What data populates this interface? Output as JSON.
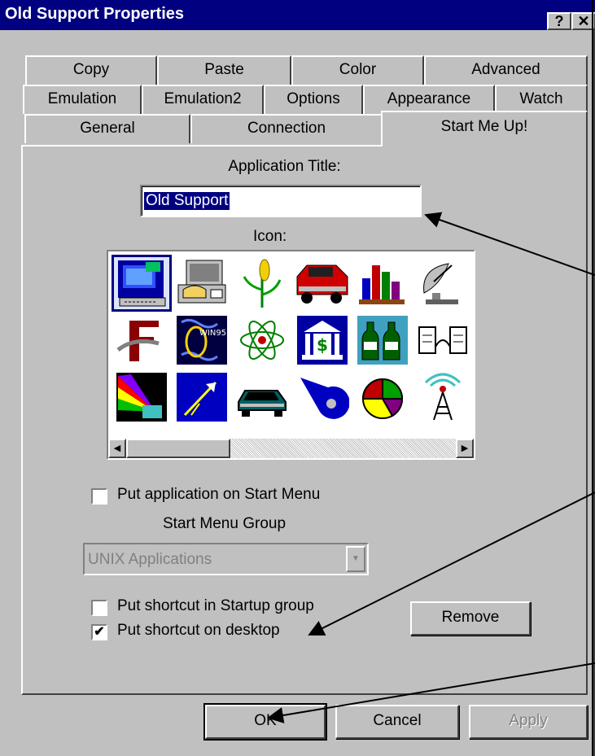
{
  "window": {
    "title": "Old Support Properties",
    "help_glyph": "?",
    "close_glyph": "✕"
  },
  "tabs": {
    "row1": [
      {
        "label": "Copy"
      },
      {
        "label": "Paste"
      },
      {
        "label": "Color"
      },
      {
        "label": "Advanced"
      }
    ],
    "row2": [
      {
        "label": "Emulation"
      },
      {
        "label": "Emulation2"
      },
      {
        "label": "Options"
      },
      {
        "label": "Appearance"
      },
      {
        "label": "Watch"
      }
    ],
    "row3": [
      {
        "label": "General"
      },
      {
        "label": "Connection"
      },
      {
        "label": "Start Me Up!",
        "active": true
      }
    ]
  },
  "panel": {
    "app_title_label": "Application Title:",
    "app_title_value": "Old Support",
    "icon_label": "Icon:",
    "icons": [
      {
        "name": "terminal-pc-icon",
        "selected": true
      },
      {
        "name": "phone-computer-icon"
      },
      {
        "name": "corn-plant-icon"
      },
      {
        "name": "red-truck-icon"
      },
      {
        "name": "bar-chart-icon"
      },
      {
        "name": "satellite-dish-icon"
      },
      {
        "name": "letter-f-icon"
      },
      {
        "name": "unix-win95-icon"
      },
      {
        "name": "atom-icon"
      },
      {
        "name": "bank-dollar-icon"
      },
      {
        "name": "bottles-icon"
      },
      {
        "name": "network-link-icon"
      },
      {
        "name": "rainbow-light-icon"
      },
      {
        "name": "launch-arrow-icon"
      },
      {
        "name": "car-icon"
      },
      {
        "name": "cable-reel-icon"
      },
      {
        "name": "pie-chart-icon"
      },
      {
        "name": "radio-tower-icon"
      }
    ],
    "start_menu_checkbox": {
      "label": "Put application on Start Menu",
      "checked": false
    },
    "start_menu_group_label": "Start Menu Group",
    "start_menu_group_value": "UNIX Applications",
    "startup_checkbox": {
      "label": "Put shortcut in Startup group",
      "checked": false
    },
    "desktop_checkbox": {
      "label": "Put shortcut on desktop",
      "checked": true,
      "mark": "✔"
    },
    "remove_button": "Remove"
  },
  "footer": {
    "ok": "OK",
    "cancel": "Cancel",
    "apply": "Apply"
  },
  "scroll": {
    "left_glyph": "◀",
    "right_glyph": "▶",
    "down_glyph": "▼"
  },
  "colors": {
    "titlebar": "#000080",
    "face": "#c0c0c0",
    "selection": "#000080"
  }
}
